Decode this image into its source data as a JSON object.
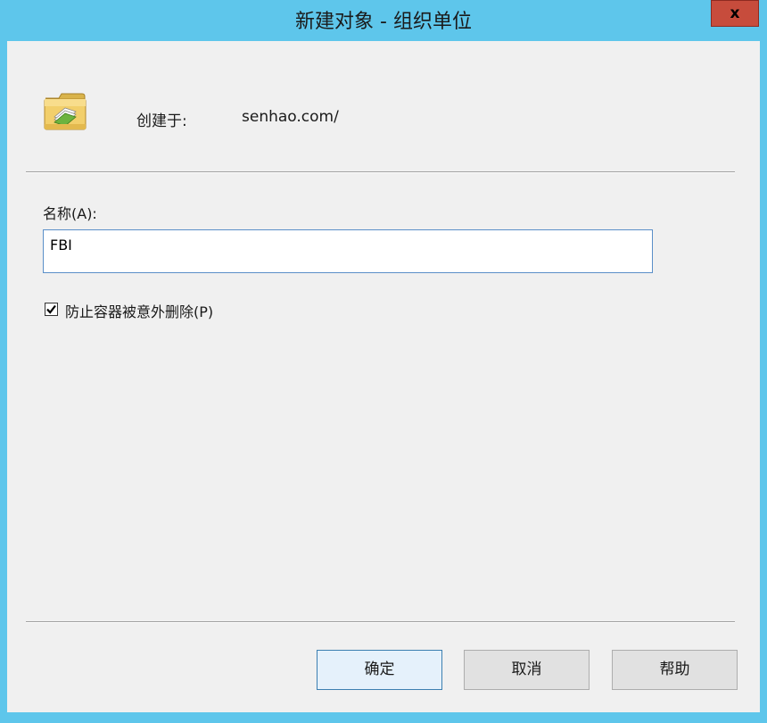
{
  "window": {
    "title": "新建对象 - 组织单位",
    "close_label": "x"
  },
  "header": {
    "icon": "folder-icon",
    "created_in_label": "创建于:",
    "created_in_value": "senhao.com/"
  },
  "form": {
    "name_label": "名称(A):",
    "name_value": "FBI",
    "protect_checkbox_label": "防止容器被意外删除(P)",
    "protect_checked": true
  },
  "buttons": {
    "ok": "确定",
    "cancel": "取消",
    "help": "帮助"
  },
  "colors": {
    "frame": "#5ec6eb",
    "close_button": "#c74c3c",
    "client_background": "#f0f0f0",
    "input_border": "#5a8fc8"
  }
}
